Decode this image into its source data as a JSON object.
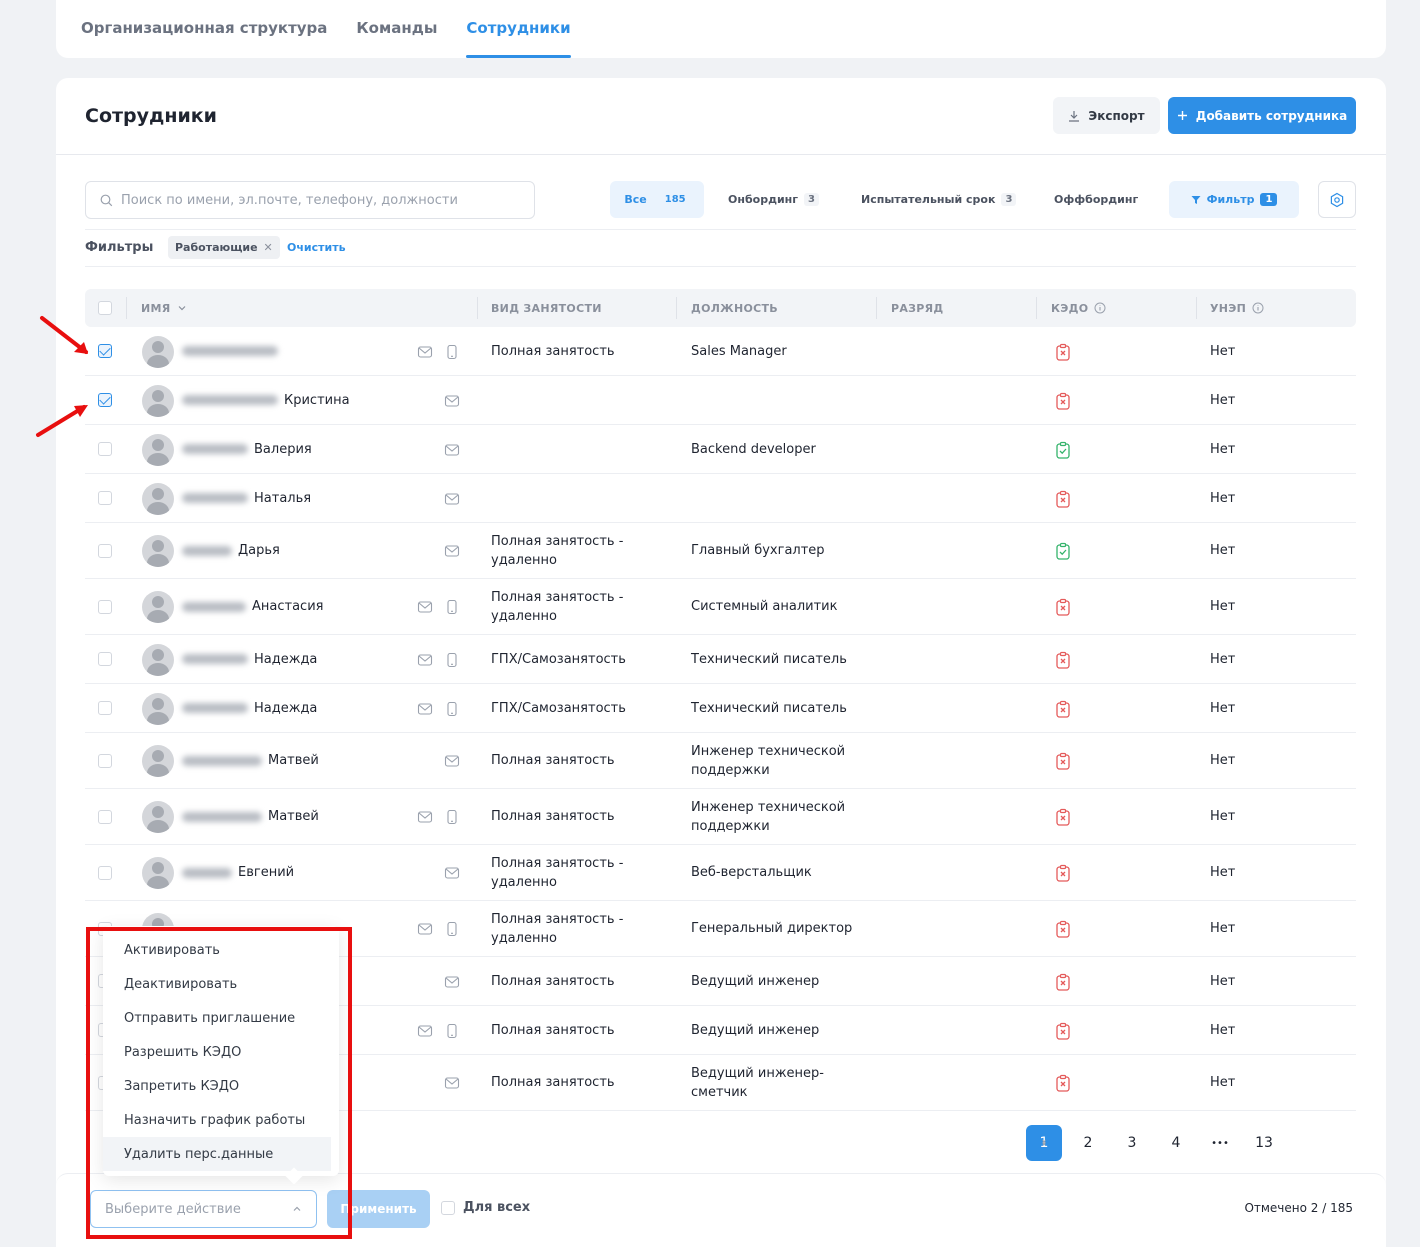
{
  "top_tabs": [
    {
      "label": "Организационная структура",
      "active": false
    },
    {
      "label": "Команды",
      "active": false
    },
    {
      "label": "Сотрудники",
      "active": true
    }
  ],
  "page": {
    "title": "Сотрудники",
    "export_label": "Экспорт",
    "add_label": "Добавить сотрудника"
  },
  "search": {
    "placeholder": "Поиск по имени, эл.почте, телефону, должности",
    "value": ""
  },
  "segments": {
    "all": {
      "label": "Все",
      "count": "185"
    },
    "onboarding": {
      "label": "Онбординг",
      "count": "3"
    },
    "probation": {
      "label": "Испытательный срок",
      "count": "3"
    },
    "offboarding": {
      "label": "Оффбординг"
    },
    "filter": {
      "label": "Фильтр",
      "count": "1"
    }
  },
  "filters": {
    "label": "Фильтры",
    "chip": "Работающие",
    "clear": "Очистить"
  },
  "columns": {
    "name": "ИМЯ",
    "employment": "ВИД ЗАНЯТОСТИ",
    "position": "ДОЛЖНОСТЬ",
    "rank": "РАЗРЯД",
    "kedo": "КЭДО",
    "unep": "УНЭП"
  },
  "rows": [
    {
      "checked": true,
      "name": "",
      "employment": "Полная занятость",
      "position": "Sales Manager",
      "kedo": "off",
      "unep": "Нет"
    },
    {
      "checked": true,
      "name": "Кристина",
      "employment": "",
      "position": "",
      "kedo": "off",
      "unep": "Нет"
    },
    {
      "checked": false,
      "name": "Валерия",
      "employment": "",
      "position": "Backend developer",
      "kedo": "on",
      "unep": "Нет"
    },
    {
      "checked": false,
      "name": "Наталья",
      "employment": "",
      "position": "",
      "kedo": "off",
      "unep": "Нет"
    },
    {
      "checked": false,
      "name": "Дарья",
      "employment": "Полная занятость - удаленно",
      "position": "Главный бухгалтер",
      "kedo": "on",
      "unep": "Нет"
    },
    {
      "checked": false,
      "name": "Анастасия",
      "employment": "Полная занятость - удаленно",
      "position": "Системный аналитик",
      "kedo": "off",
      "unep": "Нет"
    },
    {
      "checked": false,
      "name": "Надежда",
      "employment": "ГПХ/Самозанятость",
      "position": "Технический писатель",
      "kedo": "off",
      "unep": "Нет"
    },
    {
      "checked": false,
      "name": "Надежда",
      "employment": "ГПХ/Самозанятость",
      "position": "Технический писатель",
      "kedo": "off",
      "unep": "Нет"
    },
    {
      "checked": false,
      "name": "Матвей",
      "employment": "Полная занятость",
      "position": "Инженер технической поддержки",
      "kedo": "off",
      "unep": "Нет"
    },
    {
      "checked": false,
      "name": "Матвей",
      "employment": "Полная занятость",
      "position": "Инженер технической поддержки",
      "kedo": "off",
      "unep": "Нет"
    },
    {
      "checked": false,
      "name": "Евгений",
      "employment": "Полная занятость - удаленно",
      "position": "Веб-верстальщик",
      "kedo": "off",
      "unep": "Нет"
    },
    {
      "checked": false,
      "name": "",
      "employment": "Полная занятость - удаленно",
      "position": "Генеральный директор",
      "kedo": "off",
      "unep": "Нет"
    },
    {
      "checked": false,
      "name": "",
      "employment": "Полная занятость",
      "position": "Ведущий инженер",
      "kedo": "off",
      "unep": "Нет"
    },
    {
      "checked": false,
      "name": "",
      "employment": "Полная занятость",
      "position": "Ведущий инженер",
      "kedo": "off",
      "unep": "Нет"
    },
    {
      "checked": false,
      "name": "",
      "employment": "Полная занятость",
      "position": "Ведущий инженер-сметчик",
      "kedo": "off",
      "unep": "Нет"
    }
  ],
  "pagination": {
    "pages": [
      "1",
      "2",
      "3",
      "4",
      "•••",
      "13"
    ],
    "current": "1"
  },
  "action_menu": {
    "items": [
      "Активировать",
      "Деактивировать",
      "Отправить приглашение",
      "Разрешить КЭДО",
      "Запретить КЭДО",
      "Назначить график работы",
      "Удалить перс.данные"
    ],
    "hovered": "Удалить перс.данные"
  },
  "bottom_bar": {
    "select_placeholder": "Выберите действие",
    "apply_label": "Применить",
    "for_all_label": "Для всех",
    "marked": "Отмечено 2 / 185"
  },
  "colors": {
    "accent": "#2e8fe6",
    "kedo_on": "#34b36b",
    "kedo_off": "#e45a5a",
    "annotation": "#e80f0f"
  }
}
